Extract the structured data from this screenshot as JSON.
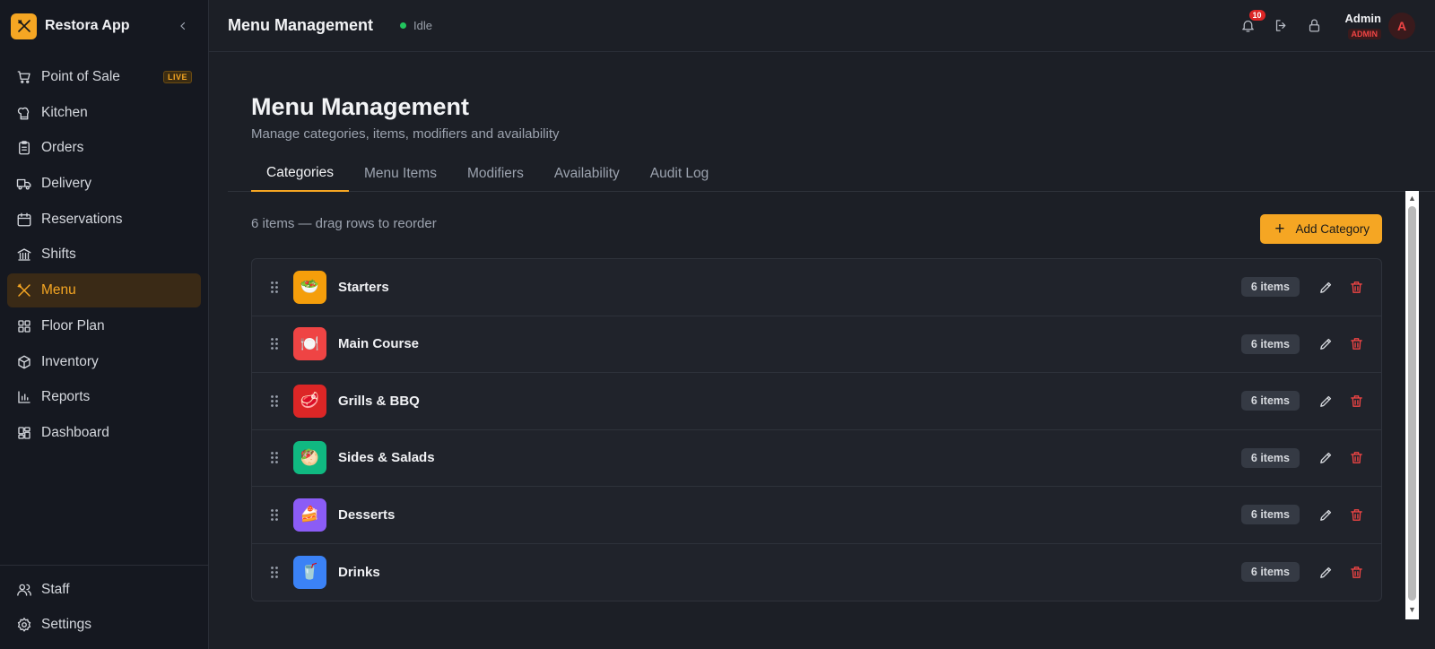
{
  "app": {
    "name": "Restora App"
  },
  "sidebar": {
    "items": [
      {
        "label": "Point of Sale",
        "icon": "cart-icon",
        "badge": "LIVE"
      },
      {
        "label": "Kitchen",
        "icon": "chef-hat-icon"
      },
      {
        "label": "Orders",
        "icon": "clipboard-icon"
      },
      {
        "label": "Delivery",
        "icon": "truck-icon"
      },
      {
        "label": "Reservations",
        "icon": "calendar-icon"
      },
      {
        "label": "Shifts",
        "icon": "bank-icon"
      },
      {
        "label": "Menu",
        "icon": "utensils-icon",
        "active": true
      },
      {
        "label": "Floor Plan",
        "icon": "grid-icon"
      },
      {
        "label": "Inventory",
        "icon": "box-icon"
      },
      {
        "label": "Reports",
        "icon": "bar-chart-icon"
      },
      {
        "label": "Dashboard",
        "icon": "dashboard-icon"
      }
    ],
    "bottom": [
      {
        "label": "Staff",
        "icon": "users-icon"
      },
      {
        "label": "Settings",
        "icon": "gear-icon"
      }
    ]
  },
  "topbar": {
    "title": "Menu Management",
    "status": "Idle",
    "notifications": "10",
    "user_name": "Admin",
    "user_role": "ADMIN",
    "avatar": "A"
  },
  "page": {
    "title": "Menu Management",
    "subtitle": "Manage categories, items, modifiers and availability",
    "tabs": [
      "Categories",
      "Menu Items",
      "Modifiers",
      "Availability",
      "Audit Log"
    ],
    "active_tab": "Categories",
    "list_meta": "6 items — drag rows to reorder",
    "add_button": "Add Category"
  },
  "categories": [
    {
      "name": "Starters",
      "count": "6 items",
      "emoji": "🥗",
      "color": "#f59e0b"
    },
    {
      "name": "Main Course",
      "count": "6 items",
      "emoji": "🍽️",
      "color": "#ef4444"
    },
    {
      "name": "Grills & BBQ",
      "count": "6 items",
      "emoji": "🥩",
      "color": "#dc2626"
    },
    {
      "name": "Sides & Salads",
      "count": "6 items",
      "emoji": "🥙",
      "color": "#10b981"
    },
    {
      "name": "Desserts",
      "count": "6 items",
      "emoji": "🍰",
      "color": "#8b5cf6"
    },
    {
      "name": "Drinks",
      "count": "6 items",
      "emoji": "🥤",
      "color": "#3b82f6"
    }
  ],
  "colors": {
    "accent": "#f5a623",
    "danger": "#ef4444",
    "success": "#22c55e"
  }
}
